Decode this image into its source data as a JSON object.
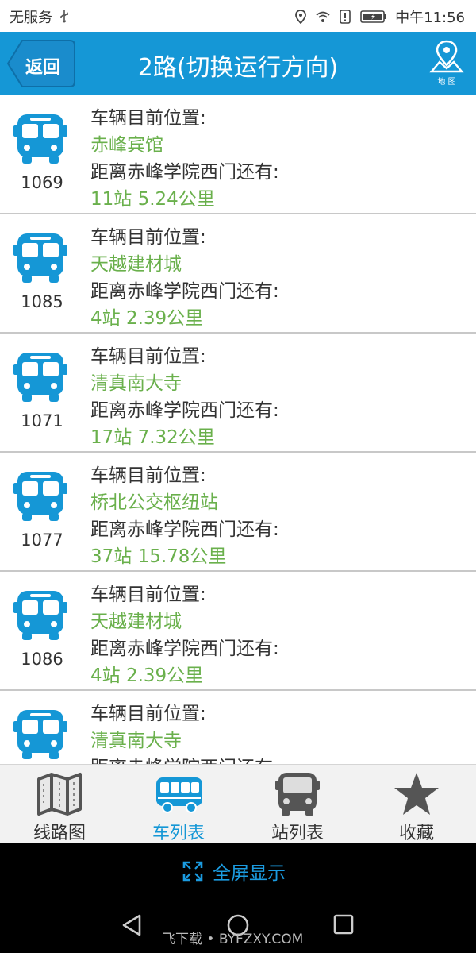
{
  "status_bar": {
    "carrier": "无服务",
    "time": "中午11:56"
  },
  "header": {
    "back_label": "返回",
    "title": "2路(切换运行方向)",
    "map_label": "地 图"
  },
  "list": {
    "position_label": "车辆目前位置:",
    "distance_label": "距离赤峰学院西门还有:",
    "vehicles": [
      {
        "number": "1069",
        "location": "赤峰宾馆",
        "distance": "11站  5.24公里"
      },
      {
        "number": "1085",
        "location": "天越建材城",
        "distance": "4站  2.39公里"
      },
      {
        "number": "1071",
        "location": "清真南大寺",
        "distance": "17站  7.32公里"
      },
      {
        "number": "1077",
        "location": "桥北公交枢纽站",
        "distance": "37站  15.78公里"
      },
      {
        "number": "1086",
        "location": "天越建材城",
        "distance": "4站  2.39公里"
      },
      {
        "number": "",
        "location": "清真南大寺",
        "distance": ""
      }
    ]
  },
  "tabs": [
    {
      "label": "线路图",
      "icon": "map-icon",
      "active": false
    },
    {
      "label": "车列表",
      "icon": "bus-front-icon",
      "active": true
    },
    {
      "label": "站列表",
      "icon": "bus-stop-icon",
      "active": false
    },
    {
      "label": "收藏",
      "icon": "star-icon",
      "active": false
    }
  ],
  "fullscreen": {
    "label": "全屏显示"
  },
  "watermark": "飞下载 • BYFZXY.COM",
  "colors": {
    "primary": "#1597d6",
    "accent_green": "#6ab04c",
    "tab_bg": "#f2f2f2"
  }
}
